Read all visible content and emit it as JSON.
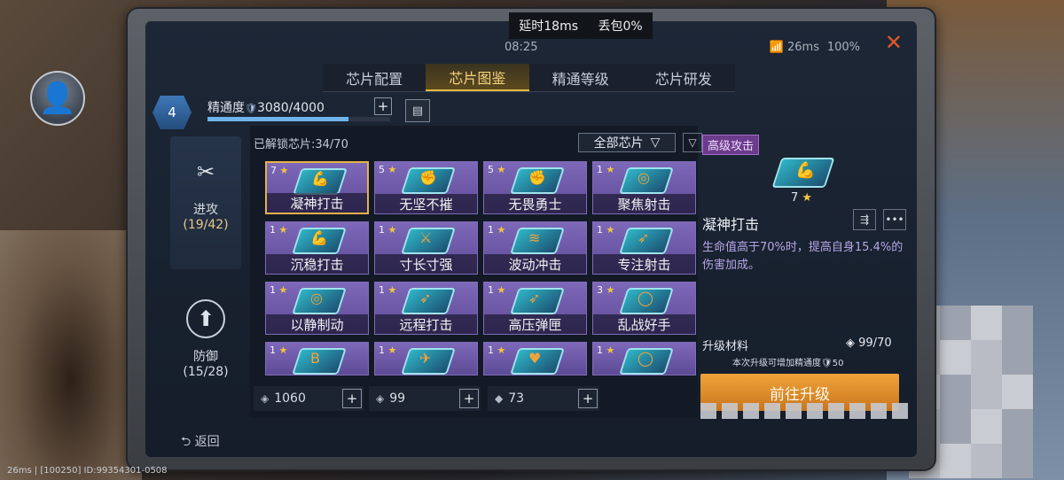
{
  "hud": {
    "latency": "延时18ms",
    "packet_loss": "丢包0%",
    "clock": "08:25",
    "net": "26ms",
    "battery": "100%"
  },
  "tabs": [
    {
      "label": "芯片配置",
      "active": false
    },
    {
      "label": "芯片图鉴",
      "active": true
    },
    {
      "label": "精通等级",
      "active": false
    },
    {
      "label": "芯片研发",
      "active": false
    }
  ],
  "mastery": {
    "level": "4",
    "label": "精通度",
    "value": "3080/4000",
    "progress": 0.77
  },
  "categories": {
    "attack": {
      "label": "进攻",
      "count": "(19/42)"
    },
    "defense": {
      "label": "防御",
      "count": "(15/28)"
    }
  },
  "grid": {
    "unlocked": "已解锁芯片:34/70",
    "filter_selected": "全部芯片",
    "cards": [
      {
        "stars": "7",
        "name": "凝神打击",
        "icon": "arm-icon"
      },
      {
        "stars": "5",
        "name": "无坚不摧",
        "icon": "fist-icon"
      },
      {
        "stars": "5",
        "name": "无畏勇士",
        "icon": "fist-icon"
      },
      {
        "stars": "1",
        "name": "聚焦射击",
        "icon": "target-icon"
      },
      {
        "stars": "1",
        "name": "沉稳打击",
        "icon": "arm-icon"
      },
      {
        "stars": "1",
        "name": "寸长寸强",
        "icon": "blade-icon"
      },
      {
        "stars": "1",
        "name": "波动冲击",
        "icon": "wave-icon"
      },
      {
        "stars": "1",
        "name": "专注射击",
        "icon": "bullet-icon"
      },
      {
        "stars": "1",
        "name": "以静制动",
        "icon": "target-icon"
      },
      {
        "stars": "1",
        "name": "远程打击",
        "icon": "bullet-icon"
      },
      {
        "stars": "1",
        "name": "高压弹匣",
        "icon": "bullet-icon"
      },
      {
        "stars": "3",
        "name": "乱战好手",
        "icon": "ring-icon"
      },
      {
        "stars": "1",
        "name": "",
        "icon": "b-icon"
      },
      {
        "stars": "1",
        "name": "",
        "icon": "wing-icon"
      },
      {
        "stars": "1",
        "name": "",
        "icon": "heart-icon"
      },
      {
        "stars": "1",
        "name": "",
        "icon": "ring-icon"
      }
    ]
  },
  "resources": [
    {
      "value": "1060"
    },
    {
      "value": "99"
    },
    {
      "value": "73"
    }
  ],
  "detail": {
    "tag": "高级攻击",
    "stars": "7",
    "name": "凝神打击",
    "description": "生命值高于70%时，提高自身15.4%的伤害加成。",
    "materials_label": "升级材料",
    "materials_count": "99/70",
    "note": "本次升级可增加精通度",
    "note_value": "50",
    "upgrade_label": "前往升级"
  },
  "back_label": "返回",
  "footer": "26ms | [100250] ID:99354301-0508",
  "colors": {
    "accent": "#e5b93b",
    "card_purple": "#6d58a8",
    "upgrade_orange": "#e08f2c"
  }
}
